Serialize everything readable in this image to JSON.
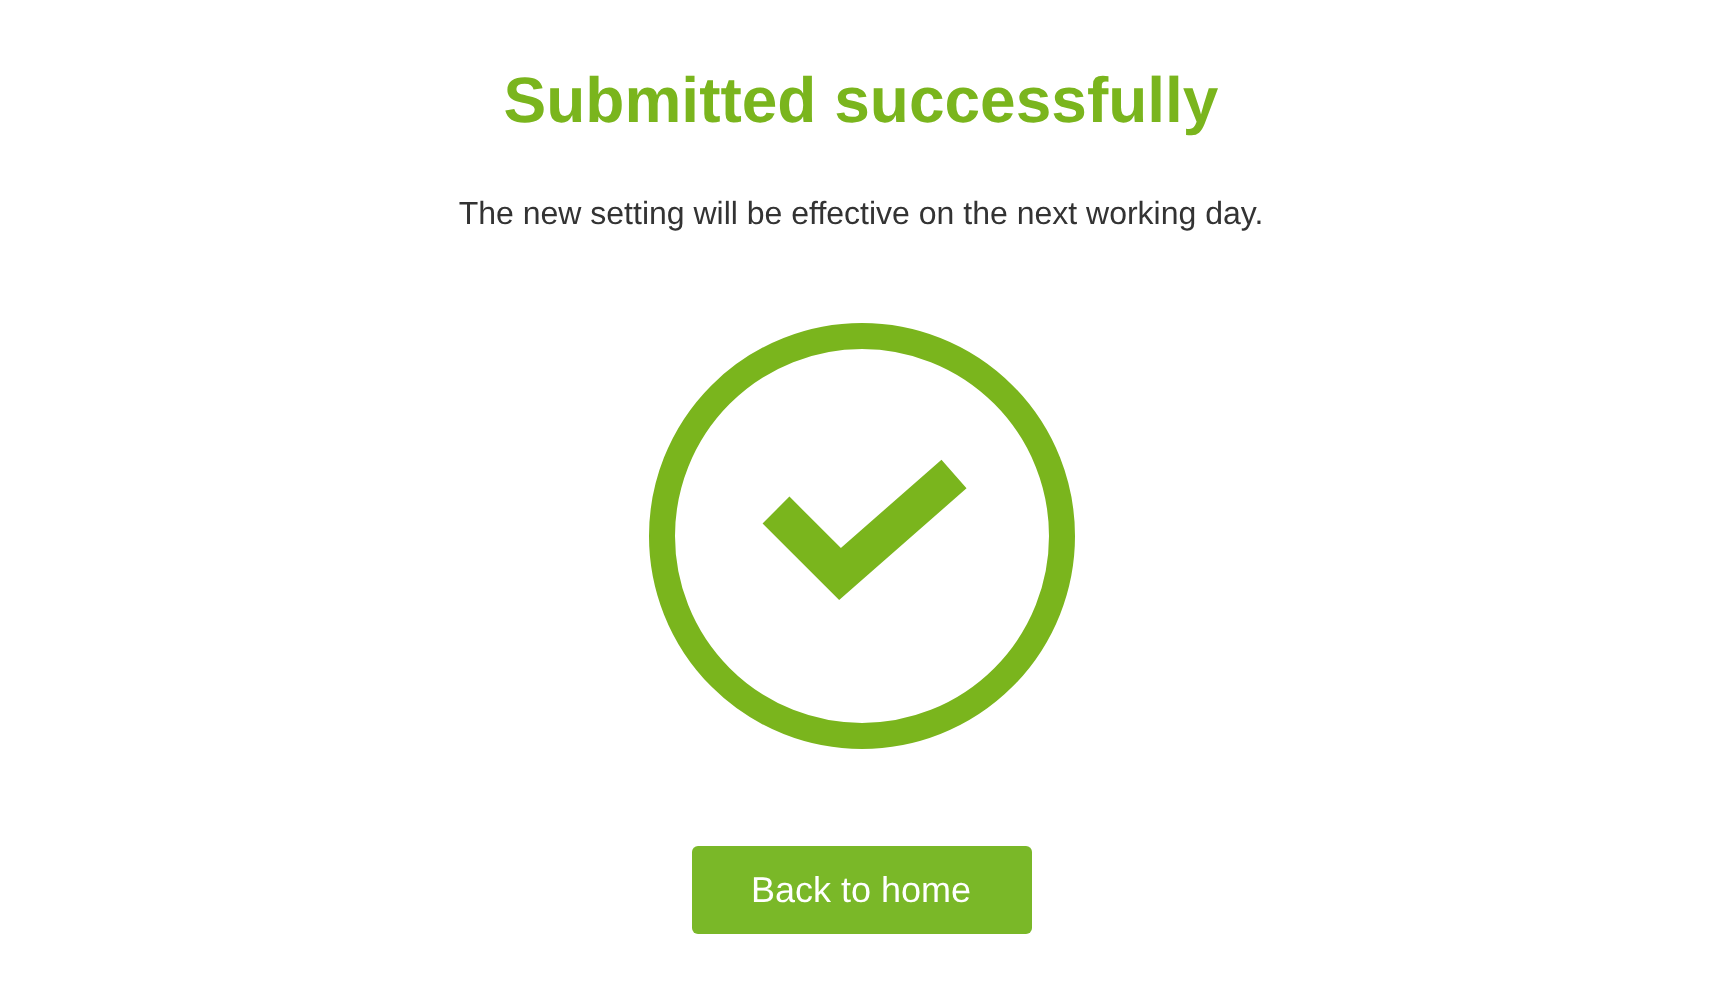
{
  "title": "Submitted successfully",
  "message": "The new setting will be effective on the next working day.",
  "button": {
    "label": "Back to home"
  }
}
